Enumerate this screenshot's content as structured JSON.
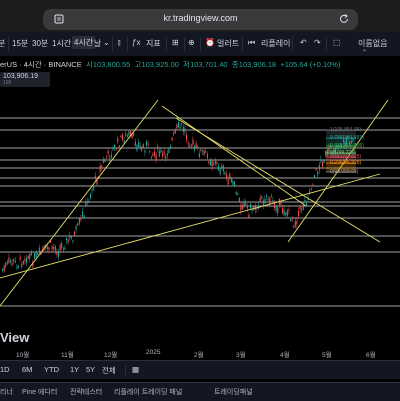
{
  "browser": {
    "url": "kr.tradingview.com"
  },
  "toolbar": {
    "items": [
      "15분",
      "30분",
      "1시간",
      "4시간",
      "날",
      "지표",
      "얼러트",
      "리플레이",
      "이름없음"
    ],
    "active": "4시간"
  },
  "legend": {
    "symbol": "erUS · 4시간 · BINANCE",
    "open_label": "시",
    "open": "103,800.55",
    "high_label": "고",
    "high": "103,925.00",
    "low_label": "저",
    "low": "103,701.40",
    "close_label": "종",
    "close": "103,906.18",
    "change": "+105.64 (+0.10%)"
  },
  "price_box": {
    "price": "103,906.19",
    "sub": "105"
  },
  "fib_levels": [
    {
      "ratio": "1",
      "price": "105,864.96"
    },
    {
      "ratio": "0.786",
      "price": "103,581"
    },
    {
      "ratio": "0.618",
      "price": "100,895"
    },
    {
      "ratio": "0.5",
      "price": "99,227"
    },
    {
      "ratio": "0.382",
      "price": "97,825"
    },
    {
      "ratio": "0.236",
      "price": "95,328"
    },
    {
      "ratio": "0",
      "price": "92,058.65"
    }
  ],
  "watermark": "View",
  "time_axis": [
    "10월",
    "11월",
    "12월",
    "2025",
    "2월",
    "3월",
    "4월",
    "5월",
    "6월"
  ],
  "ranges": [
    "1D",
    "6M",
    "YTD",
    "1Y",
    "5Y",
    "전체"
  ],
  "bottom_tabs": [
    "리너",
    "Pine 에디터",
    "전략테스터",
    "리플레이 트레이딩 패널",
    "트레이딩패널"
  ],
  "colors": {
    "background": "#000000",
    "toolbar": "#131722",
    "up": "#26a69a",
    "down": "#ef5350",
    "trendline": "#e8e06a",
    "hline": "#ffffff"
  }
}
